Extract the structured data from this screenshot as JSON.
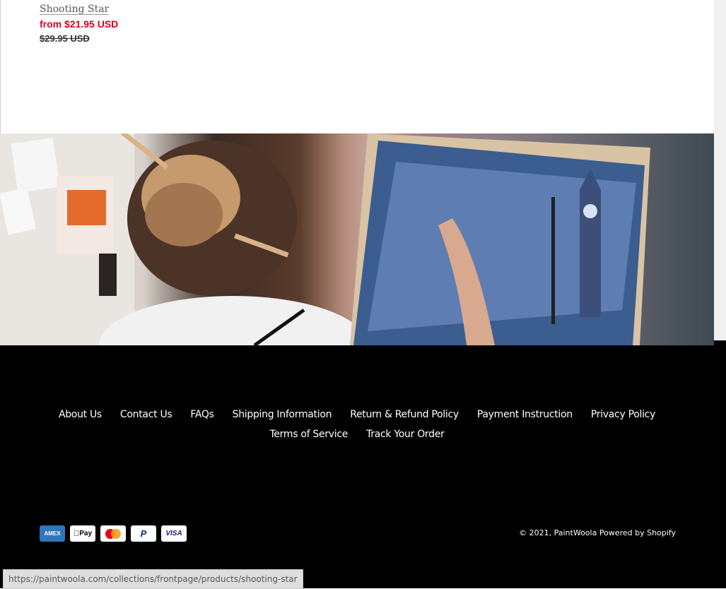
{
  "product": {
    "title": "Shooting Star",
    "price_sale": "from $21.95 USD",
    "price_compare": "$29.95 USD"
  },
  "hero": {
    "image_label": "painter-at-easel-photo"
  },
  "footer": {
    "nav_row1": [
      {
        "label": "About Us"
      },
      {
        "label": "Contact Us"
      },
      {
        "label": "FAQs"
      },
      {
        "label": "Shipping Information"
      },
      {
        "label": "Return & Refund Policy"
      },
      {
        "label": "Payment Instruction"
      },
      {
        "label": "Privacy Policy"
      }
    ],
    "nav_row2": [
      {
        "label": "Terms of Service"
      },
      {
        "label": "Track Your Order"
      }
    ],
    "payments": [
      {
        "name": "amex",
        "label": "AMEX",
        "bg": "#2e77bc",
        "fg": "#ffffff"
      },
      {
        "name": "apple-pay",
        "label": "Pay",
        "bg": "#ffffff",
        "fg": "#000000"
      },
      {
        "name": "mastercard",
        "label": "",
        "bg": "#ffffff",
        "fg": "#000000"
      },
      {
        "name": "paypal",
        "label": "P",
        "bg": "#ffffff",
        "fg": "#003087"
      },
      {
        "name": "visa",
        "label": "VISA",
        "bg": "#ffffff",
        "fg": "#1a1f71"
      }
    ],
    "copyright": "© 2021, PaintWoola Powered by Shopify"
  },
  "status_bar": {
    "url": "https://paintwoola.com/collections/frontpage/products/shooting-star"
  }
}
